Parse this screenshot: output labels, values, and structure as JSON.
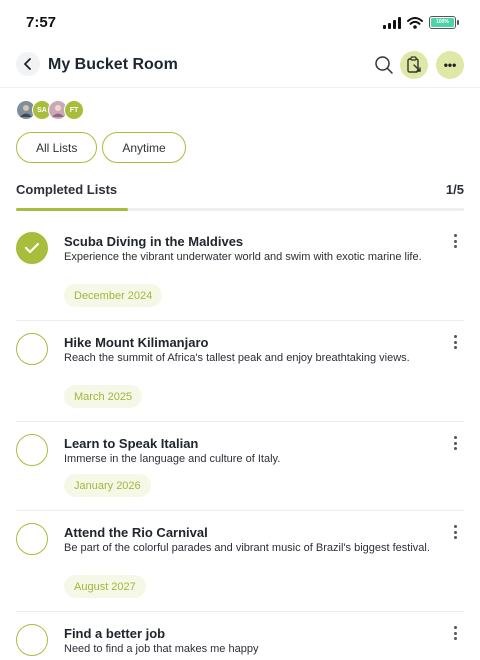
{
  "status_bar": {
    "time": "7:57",
    "battery_label": "100%"
  },
  "header": {
    "title": "My Bucket Room",
    "back_icon": "chevron-left-icon",
    "search_icon": "search-icon",
    "share_icon": "clipboard-icon",
    "more_icon": "more-horizontal-icon",
    "more_label": "•••"
  },
  "members": [
    {
      "initials": "",
      "color": "#8a9aa8",
      "kind": "photo"
    },
    {
      "initials": "SA",
      "color": "#a9bd3d",
      "kind": "initials"
    },
    {
      "initials": "",
      "color": "#c9a8b8",
      "kind": "photo"
    },
    {
      "initials": "FT",
      "color": "#a9bd3d",
      "kind": "initials"
    }
  ],
  "filters": {
    "list_filter": "All Lists",
    "time_filter": "Anytime"
  },
  "section": {
    "title": "Completed Lists",
    "count": "1/5",
    "progress": 0.25
  },
  "colors": {
    "accent": "#a9bd3d",
    "accent_light": "#dfe8a6",
    "date_bg": "#f5f8e6"
  },
  "items": [
    {
      "title": "Scuba Diving in the Maldives",
      "description": "Experience the vibrant underwater world and swim with exotic marine life.",
      "date": "December 2024",
      "completed": true
    },
    {
      "title": "Hike Mount Kilimanjaro",
      "description": "Reach the summit of Africa's tallest peak and enjoy breathtaking views.",
      "date": "March 2025",
      "completed": false
    },
    {
      "title": "Learn to Speak Italian",
      "description": "Immerse in the language and culture of Italy.",
      "date": "January 2026",
      "completed": false
    },
    {
      "title": "Attend the Rio Carnival",
      "description": "Be part of the colorful parades and vibrant music of Brazil's biggest festival.",
      "date": "August 2027",
      "completed": false
    },
    {
      "title": "Find a better job",
      "description": "Need to find a job that makes me happy",
      "date": "",
      "completed": false
    }
  ]
}
